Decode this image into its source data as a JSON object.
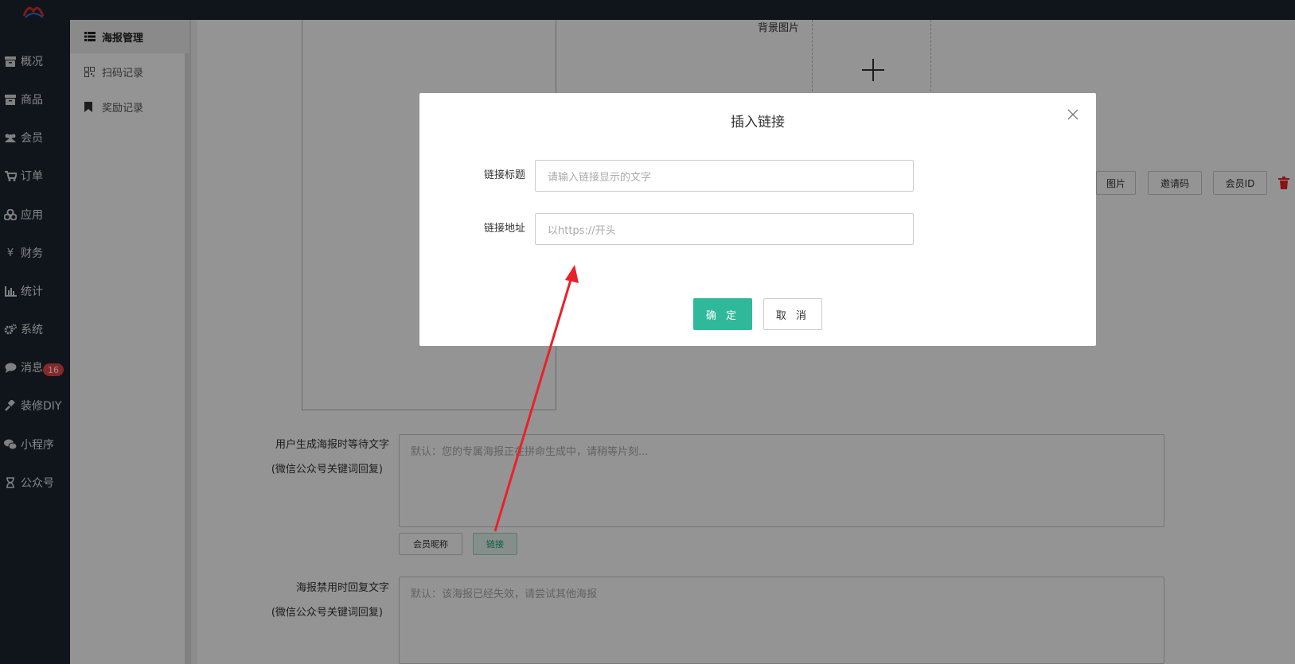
{
  "nav": {
    "items": [
      {
        "label": "概况",
        "icon": "archive-icon"
      },
      {
        "label": "商品",
        "icon": "archive-icon"
      },
      {
        "label": "会员",
        "icon": "users-icon"
      },
      {
        "label": "订单",
        "icon": "cart-icon"
      },
      {
        "label": "应用",
        "icon": "cubes-icon"
      },
      {
        "label": "财务",
        "icon": "yen-icon"
      },
      {
        "label": "统计",
        "icon": "bar-chart-icon"
      },
      {
        "label": "系统",
        "icon": "gears-icon"
      },
      {
        "label": "消息",
        "icon": "comment-icon"
      },
      {
        "label": "装修DIY",
        "icon": "gavel-icon"
      },
      {
        "label": "小程序",
        "icon": "wechat-icon"
      },
      {
        "label": "公众号",
        "icon": "hourglass-icon"
      }
    ],
    "message_badge": "16"
  },
  "subnav": {
    "items": [
      {
        "label": "海报管理",
        "icon": "list-icon",
        "active": true
      },
      {
        "label": "扫码记录",
        "icon": "qrcode-icon",
        "active": false
      },
      {
        "label": "奖励记录",
        "icon": "bookmark-icon",
        "active": false
      }
    ]
  },
  "editor": {
    "bg_image_label": "背景图片",
    "tag_buttons": [
      "图片",
      "邀请码",
      "会员ID"
    ],
    "wait_text": {
      "label": "用户生成海报时等待文字",
      "sublabel": "(微信公众号关键词回复)",
      "placeholder": "默认：您的专属海报正在拼命生成中，请稍等片刻...",
      "buttons": [
        "会员昵称",
        "链接"
      ]
    },
    "disabled_text": {
      "label": "海报禁用时回复文字",
      "sublabel": "(微信公众号关键词回复)",
      "placeholder": "默认：该海报已经失效，请尝试其他海报"
    }
  },
  "modal": {
    "title": "插入链接",
    "link_title_label": "链接标题",
    "link_title_placeholder": "请输入链接显示的文字",
    "link_url_label": "链接地址",
    "link_url_placeholder": "以https://开头",
    "ok_label": "确 定",
    "cancel_label": "取 消"
  },
  "colors": {
    "sidebar_bg": "#1c2430",
    "primary_green": "#2fb99a",
    "badge_red": "#e64545",
    "arrow_red": "#e8222a"
  }
}
